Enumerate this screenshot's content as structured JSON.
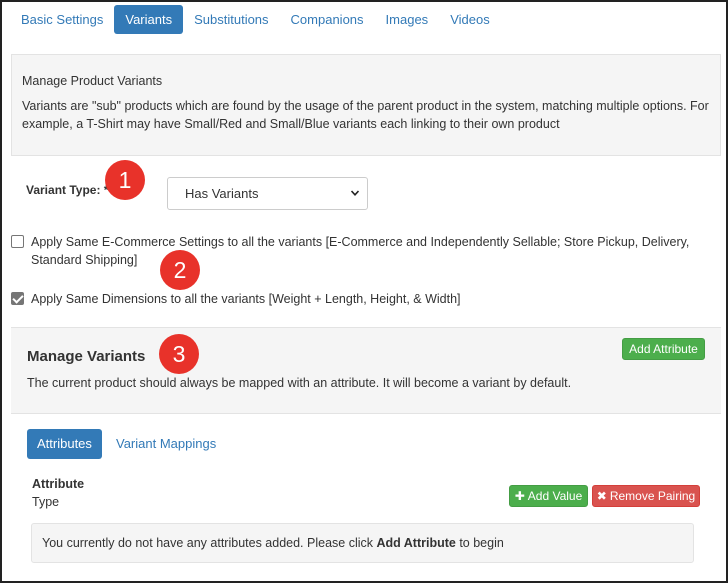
{
  "tabs": [
    {
      "label": "Basic Settings",
      "active": false
    },
    {
      "label": "Variants",
      "active": true
    },
    {
      "label": "Substitutions",
      "active": false
    },
    {
      "label": "Companions",
      "active": false
    },
    {
      "label": "Images",
      "active": false
    },
    {
      "label": "Videos",
      "active": false
    }
  ],
  "info": {
    "title": "Manage Product Variants",
    "description": "Variants are \"sub\" products which are found by the usage of the parent product in the system, matching multiple options. For example, a T-Shirt may have Small/Red and Small/Blue variants each linking to their own product"
  },
  "variant_type": {
    "label": "Variant Type: *",
    "selected": "Has Variants"
  },
  "callouts": [
    "1",
    "2",
    "3"
  ],
  "options": {
    "ecommerce": {
      "label": "Apply Same E-Commerce Settings to all the variants [E-Commerce and Independently Sellable; Store Pickup, Delivery, Standard Shipping]",
      "checked": false
    },
    "dimensions": {
      "label": "Apply Same Dimensions to all the variants [Weight + Length, Height, & Width]",
      "checked": true
    }
  },
  "manage_variants": {
    "title": "Manage Variants",
    "description": "The current product should always be mapped with an attribute. It will become a variant by default.",
    "add_attribute_label": "Add Attribute"
  },
  "subtabs": [
    {
      "label": "Attributes",
      "active": true
    },
    {
      "label": "Variant Mappings",
      "active": false
    }
  ],
  "attribute": {
    "heading": "Attribute",
    "type_label": "Type",
    "add_value_label": "Add Value",
    "remove_pairing_label": "Remove Pairing"
  },
  "empty_state": {
    "prefix": "You currently do not have any attributes added. Please click ",
    "emphasis": "Add Attribute",
    "suffix": " to begin"
  },
  "colors": {
    "primary": "#337ab7",
    "success": "#4cae4c",
    "danger": "#d9534f",
    "callout": "#e8322a"
  },
  "icons": {
    "select_arrow": "chevron-down-icon",
    "add_value": "plus-icon",
    "remove_pairing": "times-icon",
    "checkbox": "check-icon"
  }
}
